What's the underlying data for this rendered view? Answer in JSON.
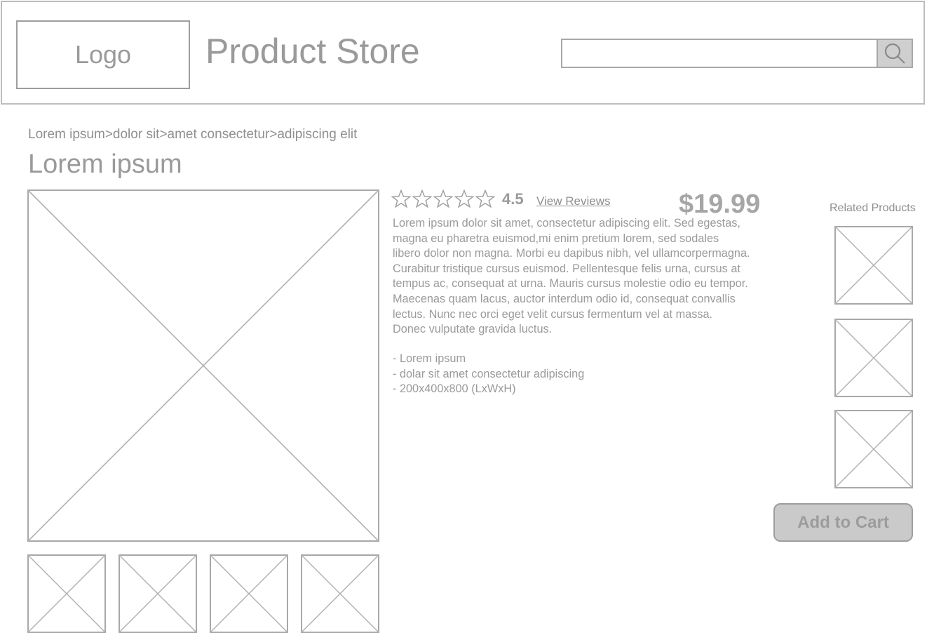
{
  "header": {
    "logo_text": "Logo",
    "store_title": "Product Store",
    "search": {
      "value": "",
      "placeholder": ""
    },
    "search_icon": "magnifier-icon"
  },
  "breadcrumb": "Lorem ipsum>dolor sit>amet consectetur>adipiscing elit",
  "product": {
    "title": "Lorem ipsum",
    "rating": {
      "stars_total": 5,
      "value": "4.5",
      "link_label": "View Reviews"
    },
    "price": "$19.99",
    "description_lines": [
      "Lorem ipsum dolor sit amet, consectetur adipiscing elit. Sed egestas,",
      "magna eu pharetra euismod,mi enim pretium lorem, sed sodales",
      "libero dolor non magna. Morbi eu dapibus nibh, vel ullamcorpermagna.",
      "Curabitur tristique cursus euismod. Pellentesque felis urna, cursus at",
      "tempus ac, consequat at urna. Mauris cursus molestie odio eu tempor.",
      "Maecenas quam lacus, auctor interdum odio id, consequat convallis",
      "lectus. Nunc nec orci eget velit cursus fermentum vel at massa.",
      "Donec vulputate gravida luctus."
    ],
    "features": [
      "- Lorem ipsum",
      "- dolar sit amet consectetur adipiscing",
      "- 200x400x800 (LxWxH)"
    ],
    "add_to_cart_label": "Add to Cart"
  },
  "related": {
    "title": "Related Products"
  },
  "colors": {
    "stroke": "#a8a8a8",
    "text": "#9a9a9a",
    "button_fill": "#cacaca",
    "search_button_fill": "#cfcfcf"
  }
}
